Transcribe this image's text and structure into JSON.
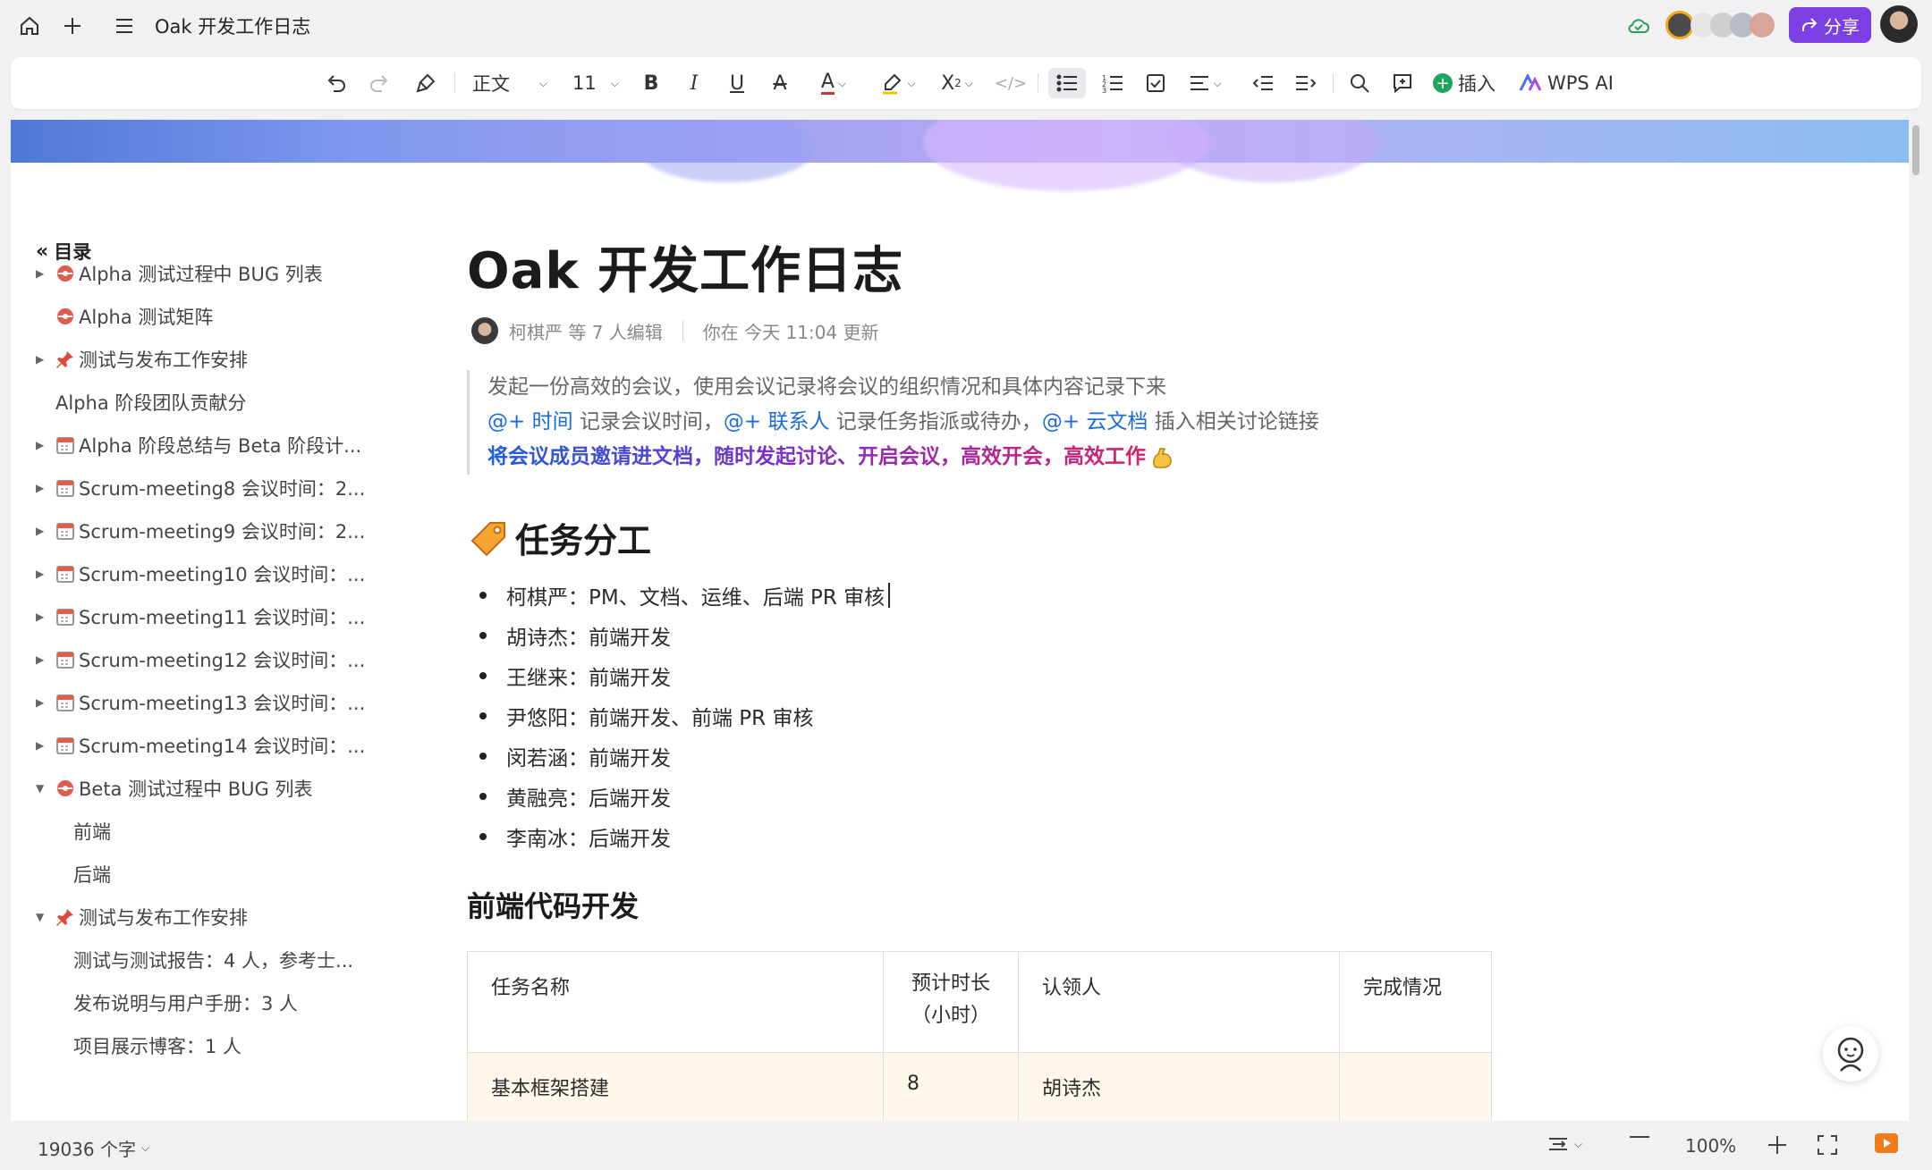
{
  "titlebar": {
    "doc_title": "Oak 开发工作日志",
    "share_label": "分享",
    "icons": [
      "home-icon",
      "plus-icon",
      "menu-icon",
      "cloud-sync-icon",
      "avatar-group",
      "share-icon",
      "user-avatar"
    ]
  },
  "toolbar": {
    "paragraph_style": "正文",
    "font_size": "11",
    "insert_label": "插入",
    "ai_label": "WPS AI"
  },
  "outline": {
    "header": "目录",
    "items": [
      {
        "label": "Alpha 测试过程中 BUG 列表",
        "icon": "bug-icon",
        "arrow": "collapsed"
      },
      {
        "label": "Alpha 测试矩阵",
        "icon": "bug-icon",
        "arrow": "none"
      },
      {
        "label": "测试与发布工作安排",
        "icon": "pin-icon",
        "arrow": "collapsed"
      },
      {
        "label": "Alpha 阶段团队贡献分",
        "icon": "",
        "arrow": "none"
      },
      {
        "label": "Alpha 阶段总结与 Beta 阶段计...",
        "icon": "calendar-icon",
        "arrow": "collapsed"
      },
      {
        "label": "Scrum-meeting8 会议时间：2...",
        "icon": "calendar-icon",
        "arrow": "collapsed"
      },
      {
        "label": "Scrum-meeting9 会议时间：2...",
        "icon": "calendar-icon",
        "arrow": "collapsed"
      },
      {
        "label": "Scrum-meeting10 会议时间：...",
        "icon": "calendar-icon",
        "arrow": "collapsed"
      },
      {
        "label": "Scrum-meeting11 会议时间：...",
        "icon": "calendar-icon",
        "arrow": "collapsed"
      },
      {
        "label": "Scrum-meeting12 会议时间：...",
        "icon": "calendar-icon",
        "arrow": "collapsed"
      },
      {
        "label": "Scrum-meeting13 会议时间：...",
        "icon": "calendar-icon",
        "arrow": "collapsed"
      },
      {
        "label": "Scrum-meeting14 会议时间：...",
        "icon": "calendar-icon",
        "arrow": "collapsed"
      },
      {
        "label": "Beta 测试过程中 BUG 列表",
        "icon": "bug-icon",
        "arrow": "expanded"
      },
      {
        "label": "前端",
        "icon": "",
        "arrow": "none"
      },
      {
        "label": "后端",
        "icon": "",
        "arrow": "none"
      },
      {
        "label": "测试与发布工作安排",
        "icon": "pin-icon",
        "arrow": "expanded"
      },
      {
        "label": "测试与测试报告：4 人，参考士...",
        "icon": "",
        "arrow": "none"
      },
      {
        "label": "发布说明与用户手册：3 人",
        "icon": "",
        "arrow": "none"
      },
      {
        "label": "项目展示博客：1 人",
        "icon": "",
        "arrow": "none"
      }
    ]
  },
  "document": {
    "title": "Oak 开发工作日志",
    "meta_editors": "柯棋严 等 7 人编辑",
    "meta_updated": "你在 今天 11:04 更新",
    "callout": {
      "line1": "发起一份高效的会议，使用会议记录将会议的组织情况和具体内容记录下来",
      "mention_time": "@+ 时间",
      "text_time": " 记录会议时间，",
      "mention_contact": "@+ 联系人",
      "text_contact": " 记录任务指派或待办，",
      "mention_doc": "@+ 云文档",
      "text_doc": " 插入相关讨论链接",
      "line3": "将会议成员邀请进文档，随时发起讨论、开启会议，高效开会，高效工作"
    },
    "section_title": "任务分工",
    "tasks": [
      "柯棋严：PM、文档、运维、后端 PR 审核",
      "胡诗杰：前端开发",
      "王继来：前端开发",
      "尹悠阳：前端开发、前端 PR 审核",
      "闵若涵：前端开发",
      "黄融亮：后端开发",
      "李南冰：后端开发"
    ],
    "subsection_title": "前端代码开发",
    "table": {
      "headers": [
        "任务名称",
        "预计时长\n（小时）",
        "认领人",
        "完成情况"
      ],
      "rows": [
        [
          "基本框架搭建",
          "8",
          "胡诗杰",
          ""
        ]
      ]
    }
  },
  "status": {
    "word_count": "19036 个字",
    "zoom": "100%"
  },
  "colors": {
    "accent": "#7b3fe4",
    "link": "#1d6bdb"
  }
}
